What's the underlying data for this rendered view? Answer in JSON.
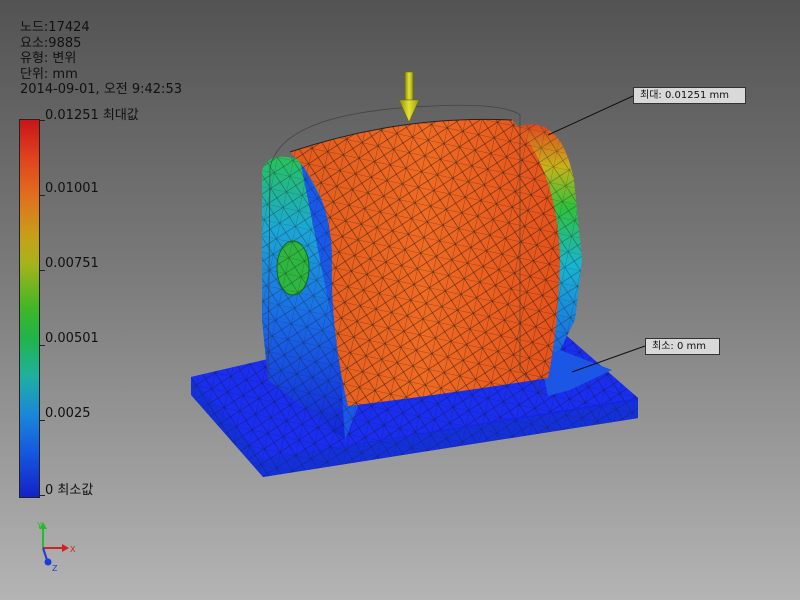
{
  "info": {
    "nodes": "노드:17424",
    "elements": "요소:9885",
    "type": "유형: 변위",
    "unit": "단위: mm",
    "timestamp": "2014-09-01, 오전 9:42:53"
  },
  "legend": {
    "labels": [
      "0.01251 최대값",
      "0.01001",
      "0.00751",
      "0.00501",
      "0.0025",
      "0 최소값"
    ]
  },
  "callouts": {
    "max": "최대: 0.01251 mm",
    "min": "최소: 0 mm"
  },
  "triad": {
    "x": "X",
    "y": "Y",
    "z": "Z"
  },
  "colors": {
    "max": "#e8531f",
    "min": "#1321c8",
    "mid": "#3fb627"
  }
}
